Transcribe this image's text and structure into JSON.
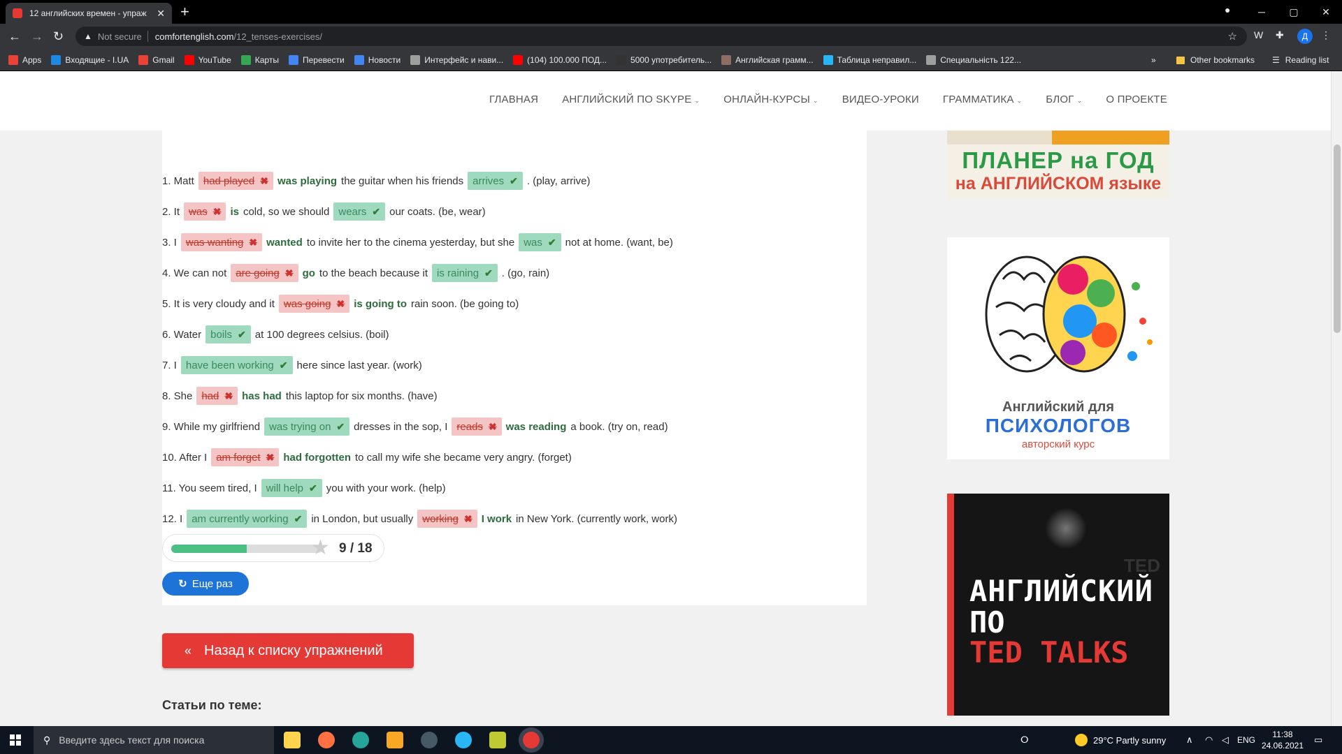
{
  "browser": {
    "tab_title": "12 английских времен - упраж",
    "tab_close": "✕",
    "new_tab": "+",
    "window_controls": [
      "─",
      "▢",
      "✕"
    ],
    "security_label": "Not secure",
    "url_host": "comfortenglish.com",
    "url_path": "/12_tenses-exercises/",
    "profile_initial": "Д",
    "bookmarks": [
      {
        "label": "Apps",
        "icon": "apps-grid-icon",
        "color": "#ea4335"
      },
      {
        "label": "Входящие - I.UA",
        "icon": "iua-icon",
        "color": "#1e88e5"
      },
      {
        "label": "Gmail",
        "icon": "gmail-icon",
        "color": "#ea4335"
      },
      {
        "label": "YouTube",
        "icon": "youtube-icon",
        "color": "#ff0000"
      },
      {
        "label": "Карты",
        "icon": "maps-icon",
        "color": "#34a853"
      },
      {
        "label": "Перевести",
        "icon": "translate-icon",
        "color": "#4285f4"
      },
      {
        "label": "Новости",
        "icon": "news-icon",
        "color": "#4285f4"
      },
      {
        "label": "Интерфейс и нави...",
        "icon": "bookmark-m-icon",
        "color": "#9e9e9e"
      },
      {
        "label": "(104) 100.000 ПОД...",
        "icon": "youtube-icon",
        "color": "#ff0000"
      },
      {
        "label": "5000 употребитель...",
        "icon": "page-icon",
        "color": "#333333"
      },
      {
        "label": "Английская грамм...",
        "icon": "se-icon",
        "color": "#8d6e63"
      },
      {
        "label": "Таблица неправил...",
        "icon": "globe-icon",
        "color": "#29b6f6"
      },
      {
        "label": "Специальність 122...",
        "icon": "circle-icon",
        "color": "#9e9e9e"
      }
    ],
    "bookmarks_overflow": "»",
    "other_bookmarks": "Other bookmarks",
    "reading_list": "Reading list"
  },
  "site_nav": [
    {
      "label": "ГЛАВНАЯ",
      "dropdown": false
    },
    {
      "label": "АНГЛИЙСКИЙ ПО SKYPE",
      "dropdown": true
    },
    {
      "label": "ОНЛАЙН-КУРСЫ",
      "dropdown": true
    },
    {
      "label": "ВИДЕО-УРОКИ",
      "dropdown": false
    },
    {
      "label": "ГРАММАТИКА",
      "dropdown": true
    },
    {
      "label": "БЛОГ",
      "dropdown": true
    },
    {
      "label": "О ПРОЕКТЕ",
      "dropdown": false
    }
  ],
  "exercise": {
    "questions": [
      {
        "parts": [
          {
            "t": "text",
            "v": "1. Matt"
          },
          {
            "t": "wrong",
            "v": "had played",
            "fix": "was playing"
          },
          {
            "t": "text",
            "v": "the guitar when his friends"
          },
          {
            "t": "right",
            "v": "arrives"
          },
          {
            "t": "text",
            "v": ". (play, arrive)"
          }
        ]
      },
      {
        "parts": [
          {
            "t": "text",
            "v": "2. It"
          },
          {
            "t": "wrong",
            "v": "was",
            "fix": "is"
          },
          {
            "t": "text",
            "v": "cold, so we should"
          },
          {
            "t": "right",
            "v": "wears"
          },
          {
            "t": "text",
            "v": "our coats. (be, wear)"
          }
        ]
      },
      {
        "parts": [
          {
            "t": "text",
            "v": "3. I"
          },
          {
            "t": "wrong",
            "v": "was wanting",
            "fix": "wanted"
          },
          {
            "t": "text",
            "v": "to invite her to the cinema yesterday, but she"
          },
          {
            "t": "right",
            "v": "was"
          },
          {
            "t": "text",
            "v": "not at home. (want, be)"
          }
        ]
      },
      {
        "parts": [
          {
            "t": "text",
            "v": "4. We can not"
          },
          {
            "t": "wrong",
            "v": "are going",
            "fix": "go"
          },
          {
            "t": "text",
            "v": "to the beach because it"
          },
          {
            "t": "right",
            "v": "is raining"
          },
          {
            "t": "text",
            "v": ". (go, rain)"
          }
        ]
      },
      {
        "parts": [
          {
            "t": "text",
            "v": "5. It is very cloudy and it"
          },
          {
            "t": "wrong",
            "v": "was going",
            "fix": "is going to"
          },
          {
            "t": "text",
            "v": "rain soon. (be going to)"
          }
        ]
      },
      {
        "parts": [
          {
            "t": "text",
            "v": "6. Water"
          },
          {
            "t": "right",
            "v": "boils"
          },
          {
            "t": "text",
            "v": "at 100 degrees celsius. (boil)"
          }
        ]
      },
      {
        "parts": [
          {
            "t": "text",
            "v": "7. I"
          },
          {
            "t": "right",
            "v": "have been working"
          },
          {
            "t": "text",
            "v": "here since last year. (work)"
          }
        ]
      },
      {
        "parts": [
          {
            "t": "text",
            "v": "8. She"
          },
          {
            "t": "wrong",
            "v": "had",
            "fix": "has had"
          },
          {
            "t": "text",
            "v": "this laptop for six months. (have)"
          }
        ]
      },
      {
        "parts": [
          {
            "t": "text",
            "v": "9. While my girlfriend"
          },
          {
            "t": "right",
            "v": "was trying on"
          },
          {
            "t": "text",
            "v": "dresses in the sop, I"
          },
          {
            "t": "wrong",
            "v": "reads",
            "fix": "was reading"
          },
          {
            "t": "text",
            "v": "a book. (try on, read)"
          }
        ]
      },
      {
        "parts": [
          {
            "t": "text",
            "v": "10. After I"
          },
          {
            "t": "wrong",
            "v": "am forget",
            "fix": "had forgotten"
          },
          {
            "t": "text",
            "v": "to call my wife she became very angry. (forget)"
          }
        ]
      },
      {
        "parts": [
          {
            "t": "text",
            "v": "11. You seem tired, I"
          },
          {
            "t": "right",
            "v": "will help"
          },
          {
            "t": "text",
            "v": "you with your work. (help)"
          }
        ]
      },
      {
        "parts": [
          {
            "t": "text",
            "v": "12. I"
          },
          {
            "t": "right",
            "v": "am currently working"
          },
          {
            "t": "text",
            "v": "in London, but usually"
          },
          {
            "t": "wrong",
            "v": "working",
            "fix": "I work"
          },
          {
            "t": "text",
            "v": "in New York. (currently work, work)"
          }
        ]
      }
    ],
    "score_text": "9 / 18",
    "score_fraction": 0.5,
    "retry_label": "Еще раз"
  },
  "back_button": "Назад к списку упражнений",
  "related_heading": "Статьи по теме:",
  "sidebar": {
    "banner1": {
      "line1": "ПЛАНЕР на ГОД",
      "line2": "на АНГЛИЙСКОМ языке"
    },
    "banner2": {
      "line1": "Английский для",
      "line2": "ПСИХОЛОГОВ",
      "line3": "авторский курс"
    },
    "banner3": {
      "line1": "АНГЛИЙСКИЙ",
      "line2": "ПО",
      "line3": "TED TALKS",
      "watermark": "TED"
    }
  },
  "taskbar": {
    "search_placeholder": "Введите здесь текст для поиска",
    "weather": "29°C  Partly sunny",
    "lang": "ENG",
    "time": "11:38",
    "date": "24.06.2021"
  }
}
